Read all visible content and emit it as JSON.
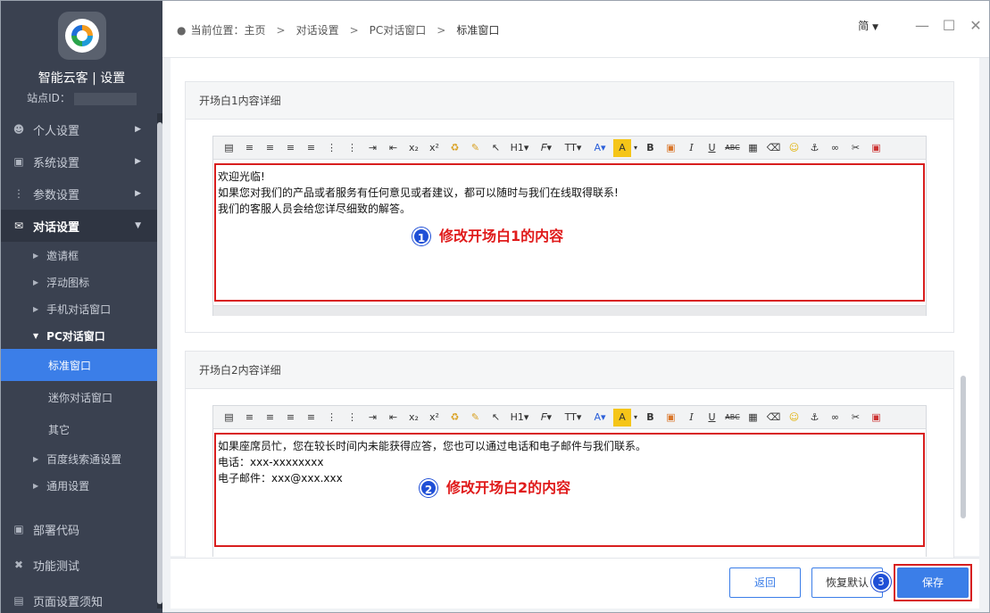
{
  "brand": {
    "title": "智能云客 | 设置",
    "site_id_label": "站点ID："
  },
  "sidebar": {
    "items": [
      {
        "label": "个人设置",
        "icon": "user-icon"
      },
      {
        "label": "系统设置",
        "icon": "monitor-icon"
      },
      {
        "label": "参数设置",
        "icon": "sliders-icon"
      },
      {
        "label": "对话设置",
        "icon": "chat-icon"
      }
    ],
    "dialog_sub": [
      {
        "label": "邀请框"
      },
      {
        "label": "浮动图标"
      },
      {
        "label": "手机对话窗口"
      },
      {
        "label": "PC对话窗口"
      }
    ],
    "pc_sub": [
      {
        "label": "标准窗口"
      },
      {
        "label": "迷你对话窗口"
      },
      {
        "label": "其它"
      }
    ],
    "more_sub": [
      {
        "label": "百度线索通设置"
      },
      {
        "label": "通用设置"
      }
    ],
    "bottom_items": [
      {
        "label": "部署代码",
        "icon": "code-icon"
      },
      {
        "label": "功能测试",
        "icon": "tools-icon"
      },
      {
        "label": "页面设置须知",
        "icon": "document-icon"
      }
    ]
  },
  "breadcrumb": {
    "prefix": "当前位置：主页",
    "level1": "对话设置",
    "level2": "PC对话窗口",
    "level3": "标准窗口"
  },
  "window": {
    "lang": "简"
  },
  "panel1": {
    "title": "开场白1内容详细",
    "lines": [
      "欢迎光临!",
      "如果您对我们的产品或者服务有任何意见或者建议，都可以随时与我们在线取得联系!",
      "我们的客服人员会给您详尽细致的解答。"
    ],
    "note_num": "1",
    "note": "修改开场白1的内容"
  },
  "panel2": {
    "title": "开场白2内容详细",
    "lines": [
      "如果座席员忙，您在较长时间内未能获得应答，您也可以通过电话和电子邮件与我们联系。",
      "电话：xxx-xxxxxxxx",
      "电子邮件：xxx@xxx.xxx"
    ],
    "note_num": "2",
    "note": "修改开场白2的内容"
  },
  "footer": {
    "back_label": "返回",
    "reset_label": "恢复默认",
    "save_label": "保存",
    "badge": "3"
  },
  "colors": {
    "accent": "#3b7ee8",
    "sidebar_bg": "#3a4150",
    "highlight_red": "#d81e1e"
  }
}
